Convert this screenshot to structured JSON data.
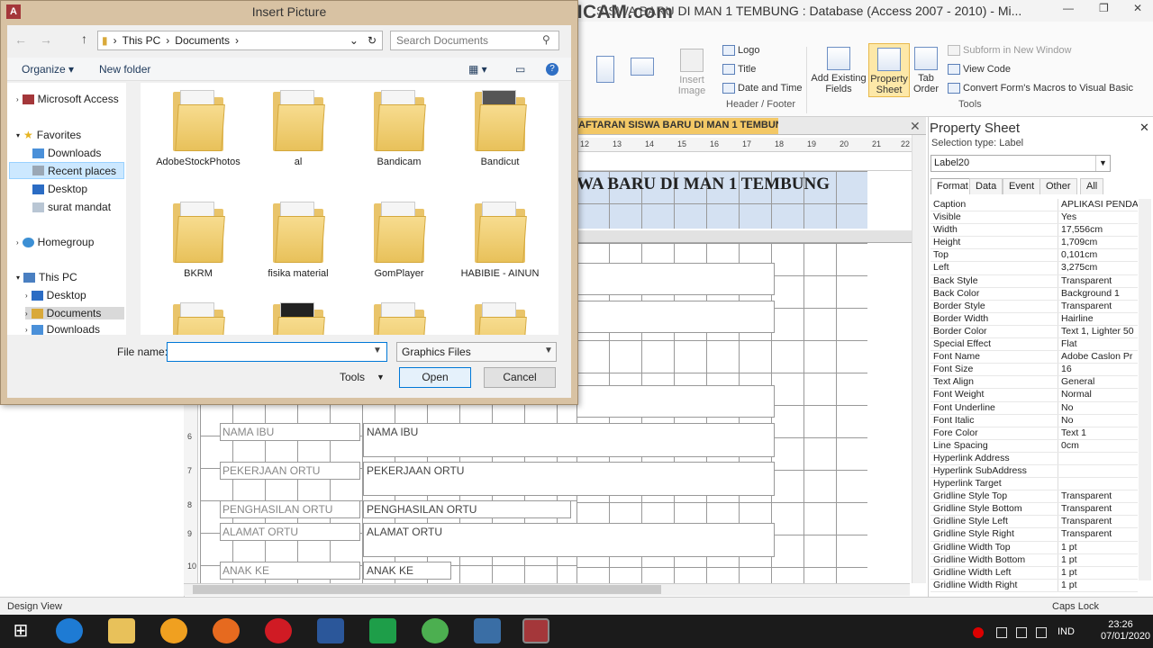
{
  "access": {
    "title": "SISWA BARU DI MAN 1 TEMBUNG : Database (Access 2007 - 2010) - Mi...",
    "app_icon": "A",
    "watermark": "www.BANDICAM.com"
  },
  "ribbon": {
    "insert_image": "Insert Image",
    "logo": "Logo",
    "title": "Title",
    "date_time": "Date and Time",
    "group_header_footer": "Header / Footer",
    "add_existing": "Add Existing Fields",
    "property_sheet": "Property Sheet",
    "tab_order": "Tab Order",
    "subform": "Subform in New Window",
    "view_code": "View Code",
    "convert_macros": "Convert Form's Macros to Visual Basic",
    "group_tools": "Tools"
  },
  "doc": {
    "tab": "AFTARAN SISWA BARU DI MAN 1 TEMBUNG",
    "header_label": "WA BARU DI MAN 1 TEMBUNG",
    "ruler_top": [
      "12",
      "13",
      "14",
      "15",
      "16",
      "17",
      "18",
      "19",
      "20",
      "21",
      "22"
    ],
    "ruler_left": [
      "6",
      "7",
      "8",
      "9",
      "10"
    ],
    "fields": [
      {
        "label": "NAMA IBU",
        "box": "NAMA IBU"
      },
      {
        "label": "PEKERJAAN ORTU",
        "box": "PEKERJAAN ORTU"
      },
      {
        "label": "PENGHASILAN ORTU",
        "box": "PENGHASILAN ORTU"
      },
      {
        "label": "ALAMAT ORTU",
        "box": "ALAMAT ORTU"
      },
      {
        "label": "ANAK KE",
        "box": "ANAK KE"
      }
    ]
  },
  "property_sheet": {
    "title": "Property Sheet",
    "selection_type": "Selection type: Label",
    "selected": "Label20",
    "tabs": [
      "Format",
      "Data",
      "Event",
      "Other",
      "All"
    ],
    "rows": [
      {
        "k": "Caption",
        "v": "APLIKASI PENDAF"
      },
      {
        "k": "Visible",
        "v": "Yes"
      },
      {
        "k": "Width",
        "v": "17,556cm"
      },
      {
        "k": "Height",
        "v": "1,709cm"
      },
      {
        "k": "Top",
        "v": "0,101cm"
      },
      {
        "k": "Left",
        "v": "3,275cm"
      },
      {
        "k": "Back Style",
        "v": "Transparent"
      },
      {
        "k": "Back Color",
        "v": "Background 1"
      },
      {
        "k": "Border Style",
        "v": "Transparent"
      },
      {
        "k": "Border Width",
        "v": "Hairline"
      },
      {
        "k": "Border Color",
        "v": "Text 1, Lighter 50"
      },
      {
        "k": "Special Effect",
        "v": "Flat"
      },
      {
        "k": "Font Name",
        "v": "Adobe Caslon Pr"
      },
      {
        "k": "Font Size",
        "v": "16"
      },
      {
        "k": "Text Align",
        "v": "General"
      },
      {
        "k": "Font Weight",
        "v": "Normal"
      },
      {
        "k": "Font Underline",
        "v": "No"
      },
      {
        "k": "Font Italic",
        "v": "No"
      },
      {
        "k": "Fore Color",
        "v": "Text 1"
      },
      {
        "k": "Line Spacing",
        "v": "0cm"
      },
      {
        "k": "Hyperlink Address",
        "v": ""
      },
      {
        "k": "Hyperlink SubAddress",
        "v": ""
      },
      {
        "k": "Hyperlink Target",
        "v": ""
      },
      {
        "k": "Gridline Style Top",
        "v": "Transparent"
      },
      {
        "k": "Gridline Style Bottom",
        "v": "Transparent"
      },
      {
        "k": "Gridline Style Left",
        "v": "Transparent"
      },
      {
        "k": "Gridline Style Right",
        "v": "Transparent"
      },
      {
        "k": "Gridline Width Top",
        "v": "1 pt"
      },
      {
        "k": "Gridline Width Bottom",
        "v": "1 pt"
      },
      {
        "k": "Gridline Width Left",
        "v": "1 pt"
      },
      {
        "k": "Gridline Width Right",
        "v": "1 pt"
      }
    ]
  },
  "status": {
    "left": "Design View",
    "right": "Caps Lock"
  },
  "dialog": {
    "title": "Insert Picture",
    "breadcrumb": [
      "This PC",
      "Documents"
    ],
    "search_placeholder": "Search Documents",
    "organize": "Organize",
    "new_folder": "New folder",
    "nav": {
      "microsoft_access": "Microsoft Access",
      "favorites": "Favorites",
      "downloads": "Downloads",
      "recent": "Recent places",
      "desktop": "Desktop",
      "surat": "surat mandat",
      "homegroup": "Homegroup",
      "thispc": "This PC",
      "pc_desktop": "Desktop",
      "pc_documents": "Documents",
      "pc_downloads": "Downloads"
    },
    "files": [
      "AdobeStockPhotos",
      "al",
      "Bandicam",
      "Bandicut",
      "BKRM",
      "fisika material",
      "GomPlayer",
      "HABIBIE - AINUN"
    ],
    "file_name_label": "File name:",
    "file_name_value": "",
    "filter": "Graphics Files",
    "tools": "Tools",
    "open": "Open",
    "cancel": "Cancel"
  },
  "tray": {
    "lang": "IND",
    "time": "23:26",
    "date": "07/01/2020"
  },
  "colors": {
    "accent": "#0078d7",
    "access_red": "#a4373a",
    "tab_orange": "#f3c866",
    "header_blue": "#d4e1f2"
  }
}
